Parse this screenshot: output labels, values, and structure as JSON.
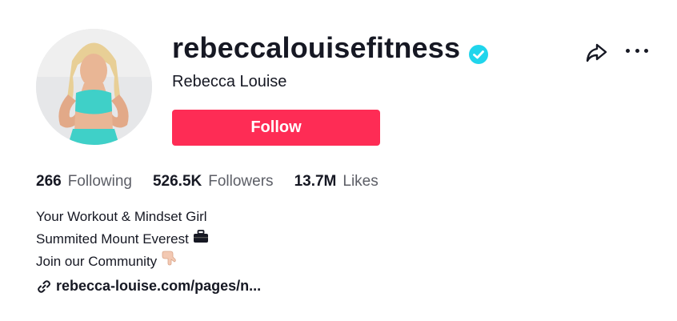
{
  "profile": {
    "username": "rebeccalouisefitness",
    "display_name": "Rebecca Louise",
    "verified": true,
    "follow_label": "Follow"
  },
  "stats": {
    "following": {
      "count": "266",
      "label": "Following"
    },
    "followers": {
      "count": "526.5K",
      "label": "Followers"
    },
    "likes": {
      "count": "13.7M",
      "label": "Likes"
    }
  },
  "bio": {
    "lines": [
      "Your Workout & Mindset Girl",
      "Summited Mount Everest",
      "Join our Community"
    ]
  },
  "link": {
    "text": "rebecca-louise.com/pages/n..."
  },
  "colors": {
    "accent": "#fe2c55",
    "verified": "#20d5ec",
    "text": "#161823",
    "muted": "#5c5e66"
  },
  "icons": [
    "verified-badge-icon",
    "share-icon",
    "more-icon",
    "briefcase-emoji-icon",
    "pointing-down-hand-icon",
    "link-icon"
  ]
}
